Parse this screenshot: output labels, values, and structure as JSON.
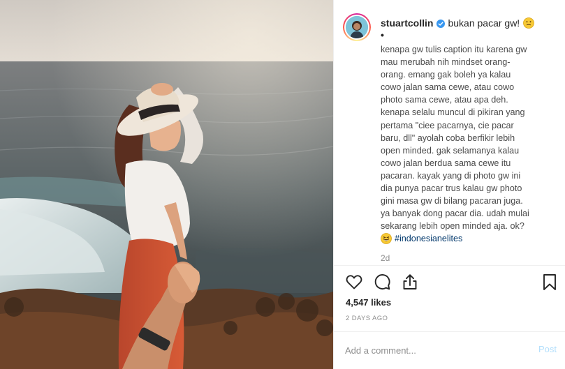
{
  "post": {
    "username": "stuartcollin",
    "first_line": "bukan pacar gw!",
    "bullet": "•",
    "caption_lines": [
      "kenapa gw tulis caption itu karena gw",
      "mau merubah nih mindset orang-",
      "orang. emang gak boleh ya kalau",
      "cowo jalan sama cewe, atau cowo",
      "photo sama cewe, atau apa deh.",
      "kenapa selalu muncul di pikiran yang",
      "pertama \"ciee pacarnya, cie pacar",
      "baru, dll\" ayolah coba berfikir lebih",
      "open minded. gak selamanya kalau",
      "cowo jalan berdua sama cewe itu",
      "pacaran. kayak yang di photo gw ini",
      "dia punya pacar trus kalau gw photo",
      "gini masa gw di bilang pacaran juga.",
      "ya banyak dong pacar dia. udah mulai",
      "sekarang lebih open minded aja. ok?"
    ],
    "hashtag": "#indonesianelites",
    "time_ago": "2d",
    "likes": "4,547 likes",
    "posted": "2 DAYS AGO"
  },
  "comment": {
    "placeholder": "Add a comment...",
    "post_label": "Post"
  },
  "icons": {
    "verified": "verified-badge-icon",
    "emoji_face": "neutral-face-emoji",
    "emoji_laugh": "grinning-squint-emoji",
    "like": "heart-icon",
    "comment": "comment-bubble-icon",
    "share": "share-icon",
    "save": "bookmark-icon"
  },
  "colors": {
    "verified": "#3897f0",
    "link": "#00376b",
    "post_disabled": "#b2dffc",
    "muted": "#8e8e8e"
  }
}
